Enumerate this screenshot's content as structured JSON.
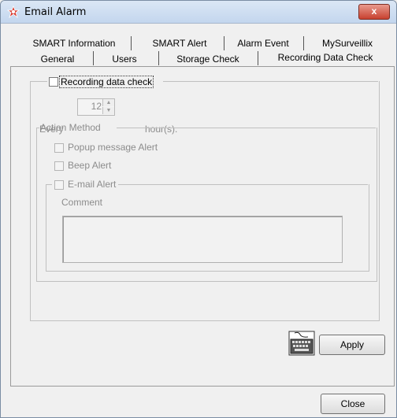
{
  "window": {
    "title": "Email Alarm",
    "close_label": "x"
  },
  "tabs_row1": [
    {
      "label": "SMART Information"
    },
    {
      "label": "SMART Alert"
    },
    {
      "label": "Alarm Event"
    },
    {
      "label": "MySurveillix"
    }
  ],
  "tabs_row2": [
    {
      "label": "General"
    },
    {
      "label": "Users"
    },
    {
      "label": "Storage Check"
    },
    {
      "label": "Recording Data Check"
    }
  ],
  "recording": {
    "checkbox_label": "Recording data check",
    "every_label": "Every",
    "hours_value": "12",
    "hours_unit": "hour(s)."
  },
  "action_method": {
    "legend": "Action Method",
    "popup_label": "Popup message Alert",
    "beep_label": "Beep Alert",
    "email_label": "E-mail Alert",
    "comment_label": "Comment",
    "comment_value": ""
  },
  "buttons": {
    "apply": "Apply",
    "close": "Close"
  }
}
